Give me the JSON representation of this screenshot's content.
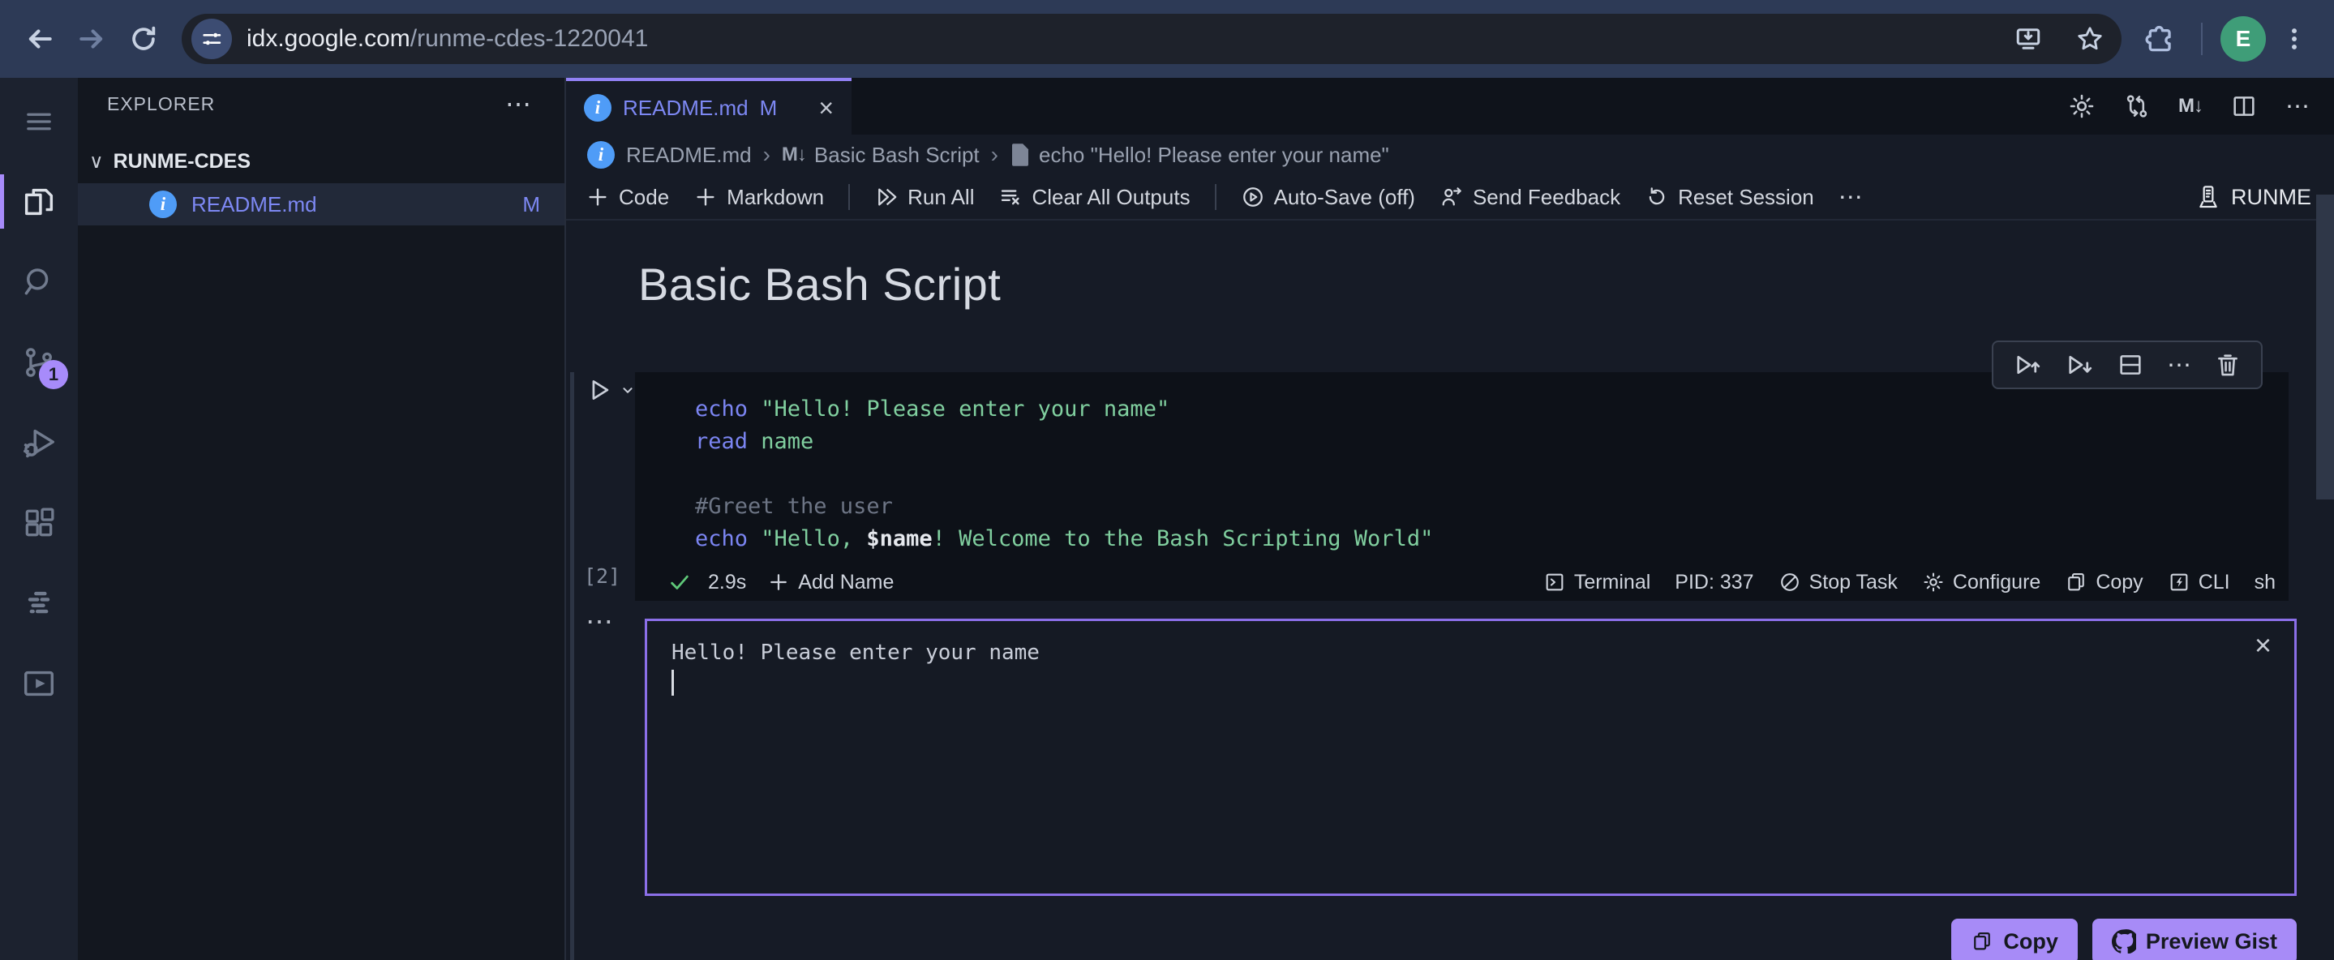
{
  "browser": {
    "url_host": "idx.google.com",
    "url_path": "/runme-cdes-1220041",
    "avatar_letter": "E"
  },
  "icons": {
    "more_h": "⋯",
    "more_v": "⋮",
    "close": "×",
    "chevron_down": "∨",
    "crumb_sep": "›",
    "markdown_glyph": "M↓",
    "info": "i"
  },
  "activity": {
    "scm_badge": "1"
  },
  "sidebar": {
    "title": "EXPLORER",
    "workspace": "RUNME-CDES",
    "file_name": "README.md",
    "file_badge": "M"
  },
  "editor": {
    "tab_label": "README.md",
    "tab_badge": "M",
    "breadcrumbs": [
      "README.md",
      "Basic Bash Script",
      "echo \"Hello! Please enter your name\""
    ],
    "heading": "Basic Bash Script"
  },
  "toolbar": {
    "code": "Code",
    "markdown": "Markdown",
    "run_all": "Run All",
    "clear_all": "Clear All Outputs",
    "autosave": "Auto-Save (off)",
    "feedback": "Send Feedback",
    "reset": "Reset Session",
    "brand": "RUNME"
  },
  "cell": {
    "exec_count": "[2]",
    "lines": [
      [
        {
          "t": "kw",
          "v": "echo"
        },
        {
          "t": "str",
          "v": " \"Hello! Please enter your name\""
        }
      ],
      [
        {
          "t": "kw",
          "v": "read"
        },
        {
          "t": "str",
          "v": " name"
        }
      ],
      [],
      [
        {
          "t": "cmt",
          "v": "#Greet the user"
        }
      ],
      [
        {
          "t": "kw",
          "v": "echo"
        },
        {
          "t": "str",
          "v": " \"Hello, "
        },
        {
          "t": "var",
          "v": "$name"
        },
        {
          "t": "str",
          "v": "! Welcome to the Bash Scripting World\""
        }
      ]
    ],
    "duration": "2.9s",
    "add_name": "Add Name",
    "terminal": "Terminal",
    "pid": "PID: 337",
    "stop": "Stop Task",
    "configure": "Configure",
    "copy": "Copy",
    "cli": "CLI",
    "shell": "sh"
  },
  "output": {
    "text": "Hello! Please enter your name"
  },
  "gist": {
    "copy_label": "Copy",
    "preview_label": "Preview Gist"
  },
  "colors": {
    "accent_purple": "#a78bfa",
    "output_border": "#8b6fe8",
    "link_blue": "#7d88f3",
    "keyword": "#7b85f2",
    "string": "#80cf9f",
    "comment": "#6d7585",
    "success_green": "#5fc979",
    "info_blue": "#4f9cf7",
    "avatar_green": "#3f9d78",
    "button_purple": "#a78bf7"
  }
}
